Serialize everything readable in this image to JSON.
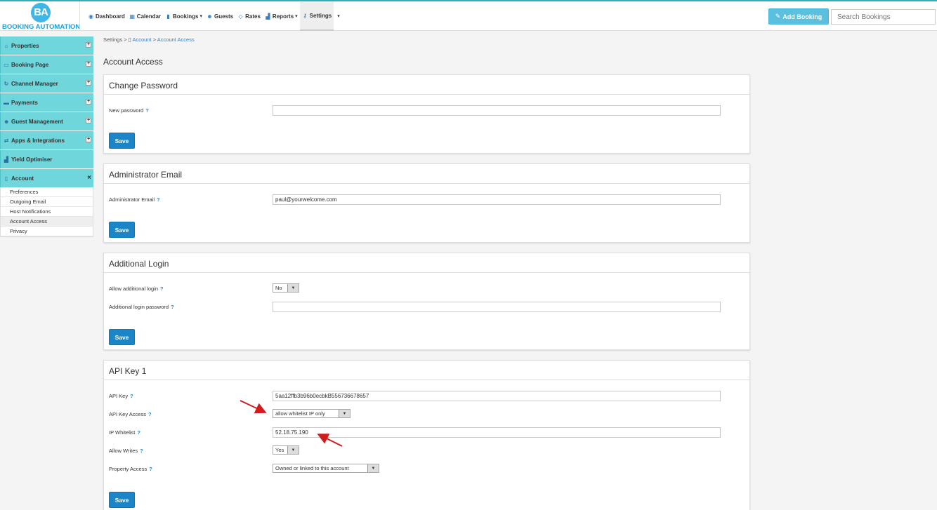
{
  "app": {
    "logo_initials": "BA",
    "logo_text": "BOOKING AUTOMATION"
  },
  "nav": {
    "items": [
      {
        "label": "Dashboard",
        "icon": "dashboard-icon"
      },
      {
        "label": "Calendar",
        "icon": "calendar-icon"
      },
      {
        "label": "Bookings",
        "icon": "bookings-icon",
        "caret": true
      },
      {
        "label": "Guests",
        "icon": "guests-icon"
      },
      {
        "label": "Rates",
        "icon": "rates-icon"
      },
      {
        "label": "Reports",
        "icon": "reports-icon",
        "caret": true
      },
      {
        "label": "Settings",
        "icon": "settings-icon",
        "active": true
      }
    ],
    "add_booking": "Add Booking",
    "search_placeholder": "Search Bookings"
  },
  "sidebar": {
    "sections": [
      {
        "label": "Properties",
        "icon": "home-icon"
      },
      {
        "label": "Booking Page",
        "icon": "monitor-icon"
      },
      {
        "label": "Channel Manager",
        "icon": "refresh-icon"
      },
      {
        "label": "Payments",
        "icon": "credit-card-icon"
      },
      {
        "label": "Guest Management",
        "icon": "guest-icon"
      },
      {
        "label": "Apps & Integrations",
        "icon": "exchange-icon"
      },
      {
        "label": "Yield Optimiser",
        "icon": "chart-icon"
      },
      {
        "label": "Account",
        "icon": "file-icon",
        "expanded": true
      }
    ],
    "account_items": [
      "Preferences",
      "Outgoing Email",
      "Host Notifications",
      "Account Access",
      "Privacy"
    ]
  },
  "breadcrumb": {
    "root": "Settings",
    "sep1": ">",
    "account": "Account",
    "sep2": ">",
    "current": "Account Access"
  },
  "page": {
    "title": "Account Access"
  },
  "change_password": {
    "title": "Change Password",
    "new_password_label": "New password",
    "new_password_value": "",
    "save": "Save"
  },
  "admin_email": {
    "title": "Administrator Email",
    "label": "Administrator Email",
    "value": "paul@yourwelcome.com",
    "save": "Save"
  },
  "additional_login": {
    "title": "Additional Login",
    "allow_label": "Allow additional login",
    "allow_value": "No",
    "password_label": "Additional login password",
    "password_value": "",
    "save": "Save"
  },
  "api_key": {
    "title": "API Key 1",
    "key_label": "API Key",
    "key_value": "5aa12ffb3b96b0ecbkB556736678657",
    "access_label": "API Key Access",
    "access_value": "allow whitelist IP only",
    "whitelist_label": "IP Whitelist",
    "whitelist_value": "52.18.75.190",
    "writes_label": "Allow Writes",
    "writes_value": "Yes",
    "property_label": "Property Access",
    "property_value": "Owned or linked to this account",
    "save": "Save"
  },
  "help_mark": "?",
  "colors": {
    "accent": "#2ab1b8",
    "sidebar": "#6fd6dc",
    "primary_button": "#1a86c8",
    "add_booking": "#5bc0de",
    "annotation": "#d01c1c"
  }
}
